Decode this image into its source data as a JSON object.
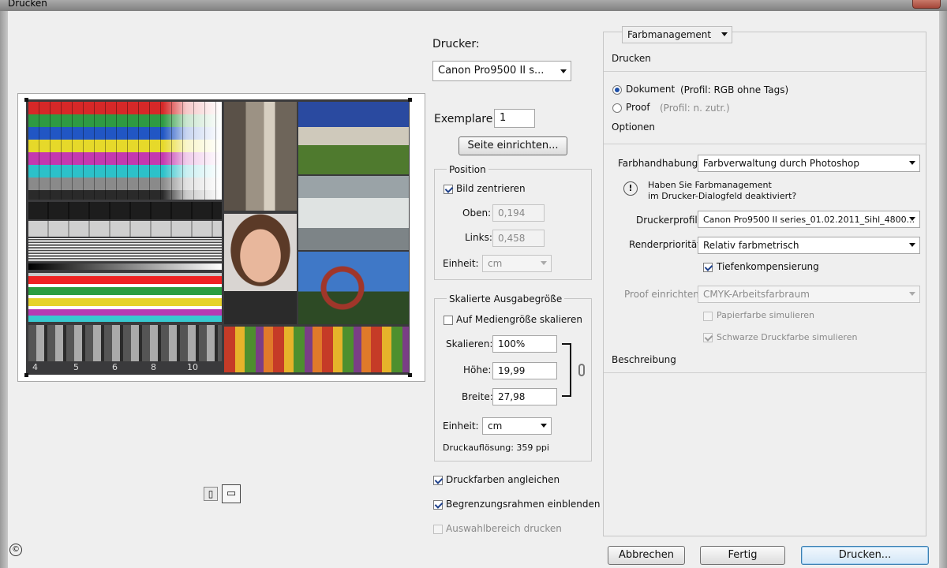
{
  "window": {
    "title": "Drucken"
  },
  "printer": {
    "label": "Drucker:",
    "value": "Canon Pro9500 II s..."
  },
  "copies": {
    "label": "Exemplare:",
    "value": "1"
  },
  "page_setup_button": "Seite einrichten...",
  "position": {
    "title": "Position",
    "center_label": "Bild zentrieren",
    "top_label": "Oben:",
    "top_value": "0,194",
    "left_label": "Links:",
    "left_value": "0,458",
    "unit_label": "Einheit:",
    "unit_value": "cm"
  },
  "scaled": {
    "title": "Skalierte Ausgabegröße",
    "fit_label": "Auf Mediengröße skalieren",
    "scale_label": "Skalieren:",
    "scale_value": "100%",
    "height_label": "Höhe:",
    "height_value": "19,99",
    "width_label": "Breite:",
    "width_value": "27,98",
    "unit_label": "Einheit:",
    "unit_value": "cm",
    "resolution": "Druckauflösung: 359 ppi"
  },
  "options_left": {
    "match_colors": "Druckfarben angleichen",
    "show_bbox": "Begrenzungsrahmen einblenden",
    "print_selection": "Auswahlbereich drucken"
  },
  "color_mgmt": {
    "dropdown": "Farbmanagement",
    "print_heading": "Drucken",
    "document_label": "Dokument",
    "document_profile": "(Profil: RGB ohne Tags)",
    "proof_label": "Proof",
    "proof_profile": "(Profil: n. zutr.)",
    "options_heading": "Optionen",
    "handling_label": "Farbhandhabung:",
    "handling_value": "Farbverwaltung durch Photoshop",
    "warning_line1": "Haben Sie Farbmanagement",
    "warning_line2": "im Drucker-Dialogfeld deaktiviert?",
    "profile_label": "Druckerprofil:",
    "profile_value": "Canon Pro9500 II series_01.02.2011_Sihl_4800...",
    "intent_label": "Renderpriorität:",
    "intent_value": "Relativ farbmetrisch",
    "bpc_label": "Tiefenkompensierung",
    "proof_setup_label": "Proof einrichten:",
    "proof_setup_value": "CMYK-Arbeitsfarbraum",
    "paper_sim": "Papierfarbe simulieren",
    "black_sim": "Schwarze Druckfarbe simulieren",
    "description_heading": "Beschreibung"
  },
  "testchart": {
    "step_labels": [
      "4",
      "5",
      "6",
      "8",
      "10"
    ]
  },
  "buttons": {
    "cancel": "Abbrechen",
    "done": "Fertig",
    "print": "Drucken..."
  },
  "icons": [
    "close-icon",
    "portrait-orientation-icon",
    "landscape-orientation-icon",
    "warning-icon",
    "chain-link-icon",
    "copyright-icon"
  ]
}
